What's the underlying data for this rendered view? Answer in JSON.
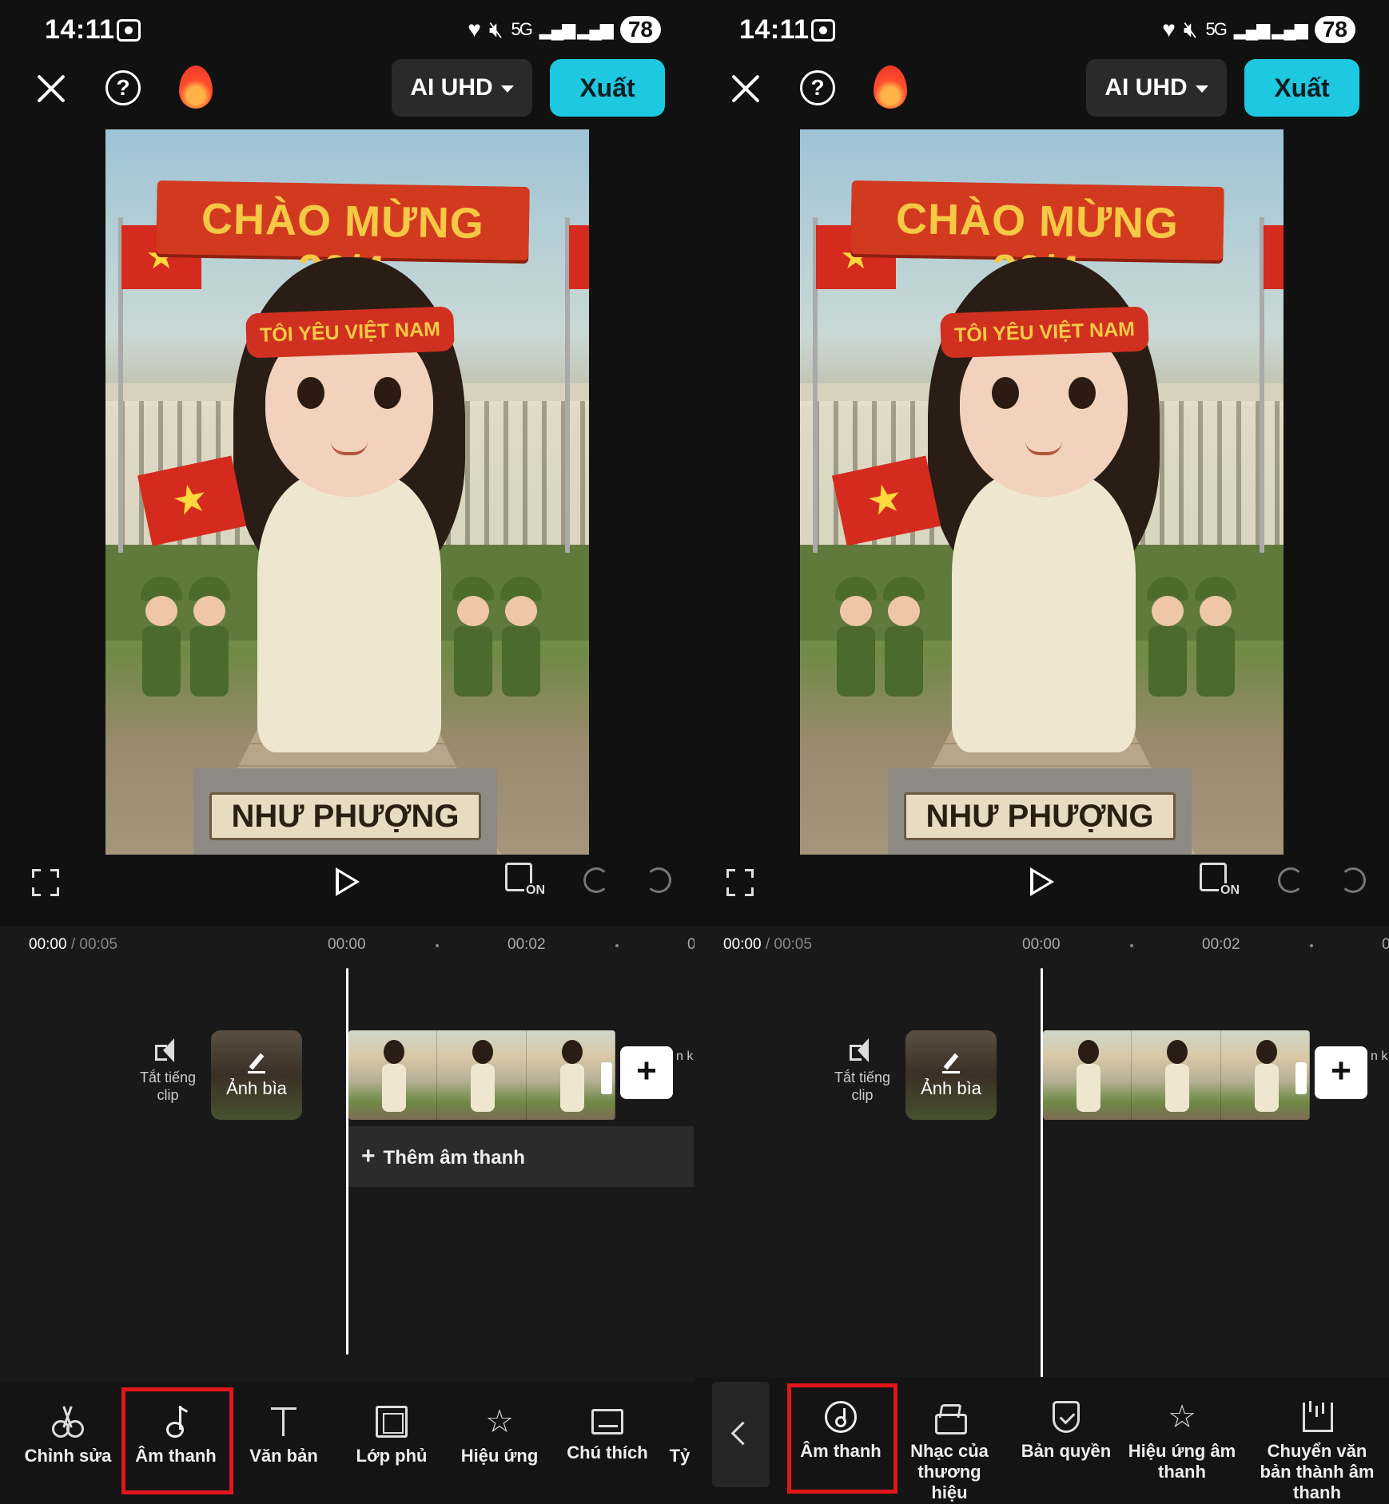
{
  "status_bar": {
    "time": "14:11",
    "network": "5G",
    "battery": "78"
  },
  "header": {
    "quality_label": "AI UHD",
    "export_label": "Xuất"
  },
  "preview": {
    "banner_text": "CHÀO MỪNG 30/4",
    "headband_text": "TÔI YÊU VIỆT NAM",
    "nameplate_text": "NHƯ PHƯỢNG"
  },
  "controls": {
    "ratio_badge": "ON"
  },
  "timeline": {
    "current_time": "00:00",
    "total_time": "/ 00:05",
    "ruler_marks": [
      "00:00",
      "00:02",
      "0"
    ],
    "mute_label_line1": "Tắt tiếng",
    "mute_label_line2": "clip",
    "cover_label": "Ảnh bìa",
    "clip_extra_text": "n k",
    "add_audio_label": "Thêm âm thanh"
  },
  "toolbar_main": {
    "items": [
      {
        "label": "Chỉnh sửa",
        "icon": "scissors-icon"
      },
      {
        "label": "Âm thanh",
        "icon": "music-note-icon",
        "highlighted": true
      },
      {
        "label": "Văn bản",
        "icon": "text-icon"
      },
      {
        "label": "Lớp phủ",
        "icon": "overlay-icon"
      },
      {
        "label": "Hiệu ứng",
        "icon": "effects-icon"
      },
      {
        "label": "Chú thích",
        "icon": "caption-icon"
      },
      {
        "label": "Tỷ",
        "icon": ""
      }
    ]
  },
  "toolbar_audio": {
    "items": [
      {
        "label": "Âm thanh",
        "icon": "audio-disc-icon",
        "highlighted": true
      },
      {
        "label_line1": "Nhạc của",
        "label_line2": "thương hiệu",
        "icon": "brand-music-icon"
      },
      {
        "label": "Bản quyền",
        "icon": "shield-icon"
      },
      {
        "label_line1": "Hiệu ứng âm",
        "label_line2": "thanh",
        "icon": "sfx-icon"
      },
      {
        "label_line1": "Chuyển văn",
        "label_line2": "bản thành âm",
        "label_line3": "thanh",
        "icon": "tts-icon"
      }
    ]
  },
  "colors": {
    "accent": "#1ec8e0",
    "highlight": "#e0161c",
    "background": "#111111"
  }
}
